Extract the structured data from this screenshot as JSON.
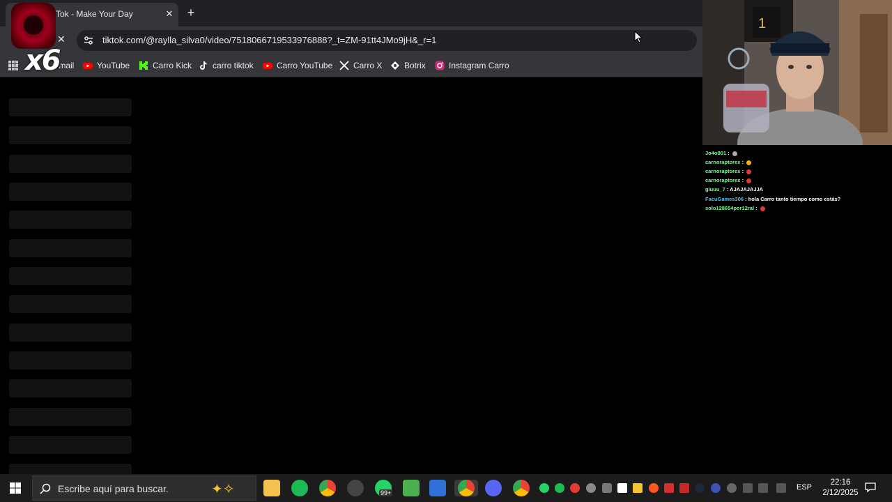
{
  "browser": {
    "tab_title": "Tok - Make Your Day",
    "tab_close": "✕",
    "new_tab": "+",
    "nav_stop": "✕",
    "url": "tiktok.com/@raylla_silva0/video/7518066719533976888?_t=ZM-91tt4JMo9jH&_r=1",
    "bookmarks": [
      {
        "label": "Gmail",
        "icon": "gmail-icon",
        "color": "#ea4335"
      },
      {
        "label": "YouTube",
        "icon": "youtube-icon",
        "color": "#ff0000"
      },
      {
        "label": "Carro Kick",
        "icon": "kick-icon",
        "color": "#53fc18"
      },
      {
        "label": "carro tiktok",
        "icon": "tiktok-icon",
        "color": "#ffffff"
      },
      {
        "label": "Carro YouTube",
        "icon": "youtube-icon",
        "color": "#ff0000"
      },
      {
        "label": "Carro X",
        "icon": "x-icon",
        "color": "#ffffff"
      },
      {
        "label": "Botrix",
        "icon": "botrix-icon",
        "color": "#ffffff"
      },
      {
        "label": "Instagram Carro",
        "icon": "instagram-icon",
        "color": "#d62976"
      }
    ]
  },
  "logo": {
    "text": "x6"
  },
  "chat": {
    "messages": [
      {
        "user": "Jo4o001",
        "text": "",
        "color": "green"
      },
      {
        "user": "carnoraptorex",
        "text": "",
        "color": "green"
      },
      {
        "user": "carnoraptorex",
        "text": "",
        "color": "green"
      },
      {
        "user": "carnoraptorex",
        "text": "",
        "color": "green"
      },
      {
        "user": "giuuu_7",
        "text": "AJAJAJAJJA",
        "color": "green"
      },
      {
        "user": "FacuGames306",
        "text": "hola Carro tanto tiempo como estás?",
        "color": "blue"
      },
      {
        "user": "solo128654por12ral",
        "text": "",
        "color": "green"
      }
    ]
  },
  "taskbar": {
    "search_placeholder": "Escribe aquí para buscar.",
    "badge": "99+",
    "language": "ESP",
    "time": "22:16",
    "date": "2/12/2025"
  },
  "colors": {
    "chrome_dark": "#202124",
    "chrome_mid": "#35363a",
    "chat_green": "#7cfc9a",
    "chat_blue": "#4fc3f7"
  }
}
